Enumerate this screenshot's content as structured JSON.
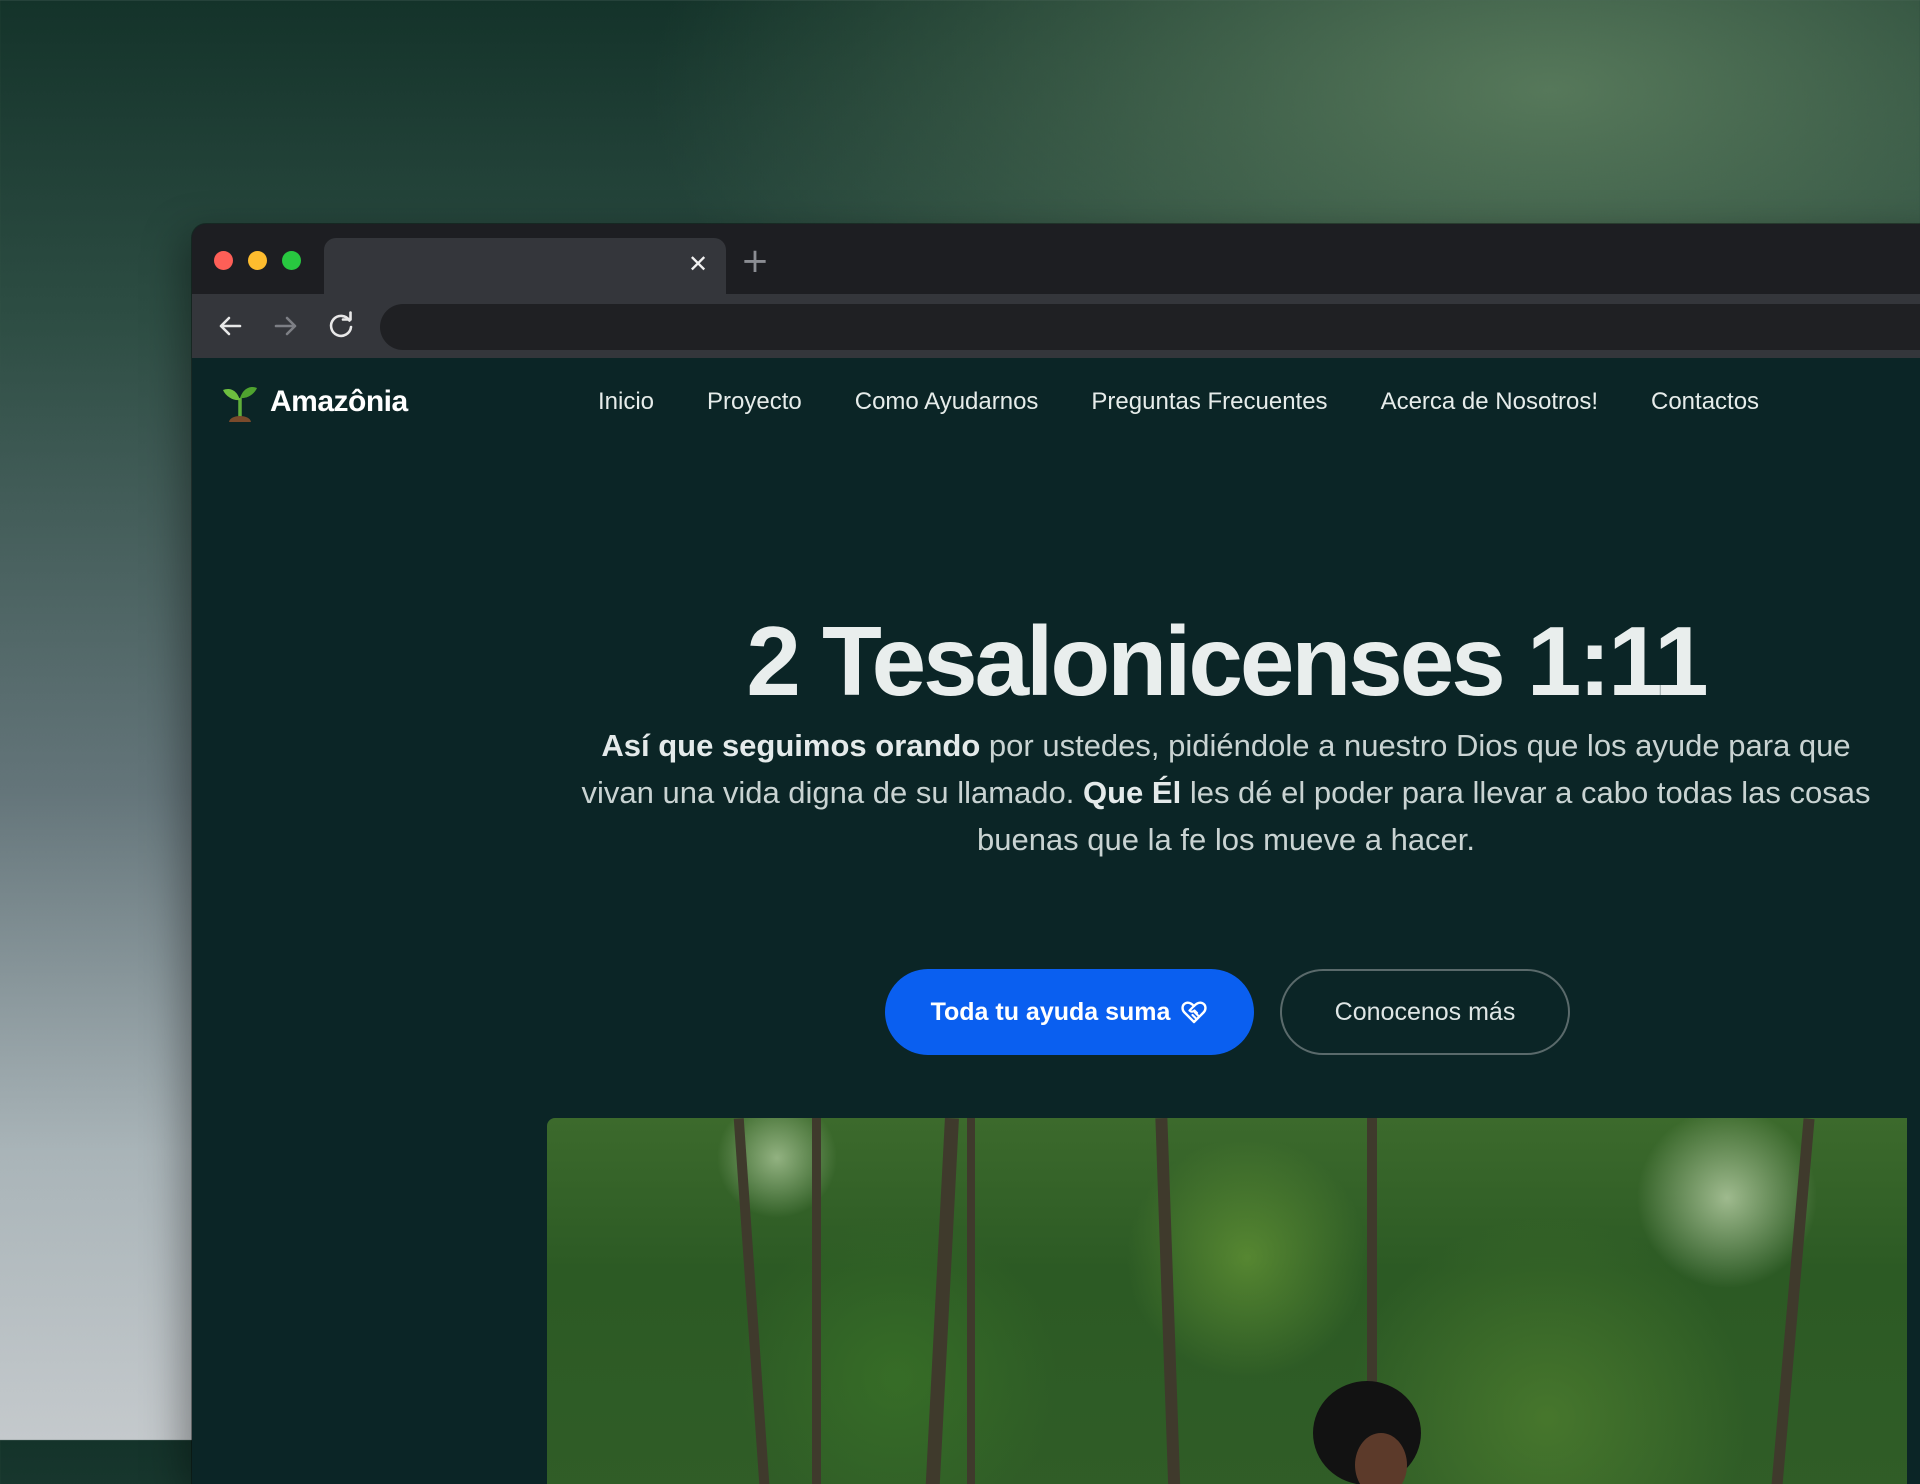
{
  "browser": {
    "tab_close_label": "✕",
    "new_tab_label": "+"
  },
  "site": {
    "brand": "Amazônia",
    "nav": [
      "Inicio",
      "Proyecto",
      "Como Ayudarnos",
      "Preguntas Frecuentes",
      "Acerca de Nosotros!",
      "Contactos"
    ]
  },
  "hero": {
    "title": "2 Tesalonicenses 1:11",
    "paragraph": {
      "bold1": "Así que seguimos orando",
      "text1": " por ustedes, pidiéndole a nuestro Dios que los ayude para que vivan una vida digna de su llamado. ",
      "bold2": "Que Él",
      "text2": " les dé el poder para llevar a cabo todas las cosas buenas que la fe los mueve a hacer."
    },
    "primary_button": "Toda tu ayuda suma",
    "secondary_button": "Conocenos más"
  },
  "icons": {
    "brand_logo": "sprout-icon",
    "button_icon": "heart-handshake-icon"
  },
  "colors": {
    "page_background": "#0b2526",
    "primary_button": "#0a5ff0"
  }
}
